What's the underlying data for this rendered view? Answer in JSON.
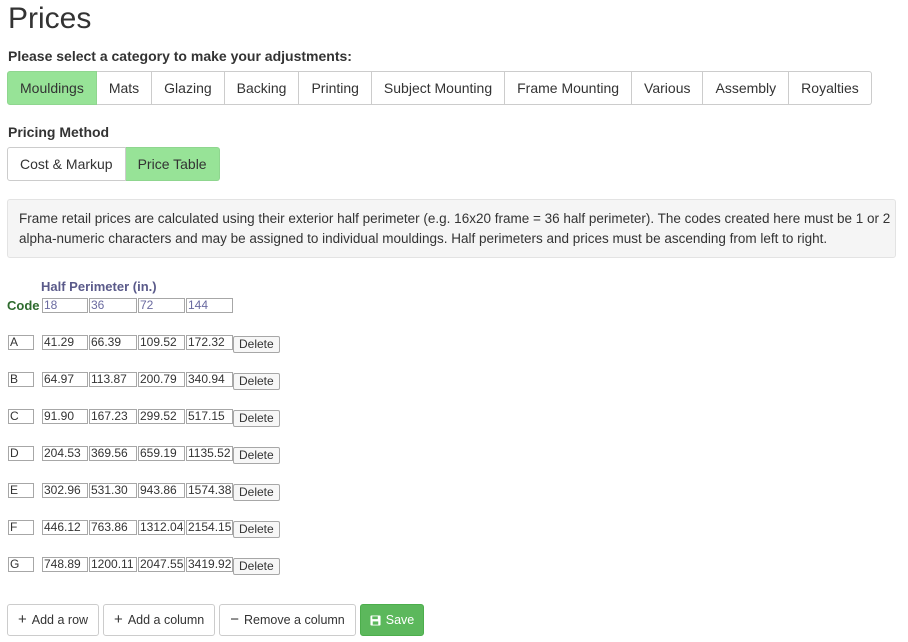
{
  "page": {
    "title": "Prices"
  },
  "category": {
    "prompt": "Please select a category to make your adjustments:",
    "tabs": [
      "Mouldings",
      "Mats",
      "Glazing",
      "Backing",
      "Printing",
      "Subject Mounting",
      "Frame Mounting",
      "Various",
      "Assembly",
      "Royalties"
    ],
    "active": "Mouldings"
  },
  "pricing_method": {
    "label": "Pricing Method",
    "options": [
      "Cost & Markup",
      "Price Table"
    ],
    "active": "Price Table"
  },
  "info": {
    "text": "Frame retail prices are calculated using their exterior half perimeter (e.g. 16x20 frame = 36 half perimeter). The codes created here must be 1 or 2 alpha-numeric characters and may be assigned to individual mouldings. Half perimeters and prices must be ascending from left to right."
  },
  "table": {
    "header_label": "Half Perimeter (in.)",
    "code_label": "Code",
    "half_perimeters": [
      "18",
      "36",
      "72",
      "144"
    ],
    "delete_label": "Delete",
    "rows": [
      {
        "code": "A",
        "prices": [
          "41.29",
          "66.39",
          "109.52",
          "172.32"
        ]
      },
      {
        "code": "B",
        "prices": [
          "64.97",
          "113.87",
          "200.79",
          "340.94"
        ]
      },
      {
        "code": "C",
        "prices": [
          "91.90",
          "167.23",
          "299.52",
          "517.15"
        ]
      },
      {
        "code": "D",
        "prices": [
          "204.53",
          "369.56",
          "659.19",
          "1135.52"
        ]
      },
      {
        "code": "E",
        "prices": [
          "302.96",
          "531.30",
          "943.86",
          "1574.38"
        ]
      },
      {
        "code": "F",
        "prices": [
          "446.12",
          "763.86",
          "1312.04",
          "2154.15"
        ]
      },
      {
        "code": "G",
        "prices": [
          "748.89",
          "1200.11",
          "2047.55",
          "3419.92"
        ]
      }
    ]
  },
  "actions": {
    "add_row": "Add a row",
    "add_column": "Add a column",
    "remove_column": "Remove a column",
    "save": "Save"
  },
  "colors": {
    "active_tab": "#97e397",
    "save_button": "#5cb85c"
  },
  "icons": {
    "add": "plus-icon",
    "remove": "minus-icon",
    "save": "floppy-disk-icon"
  }
}
